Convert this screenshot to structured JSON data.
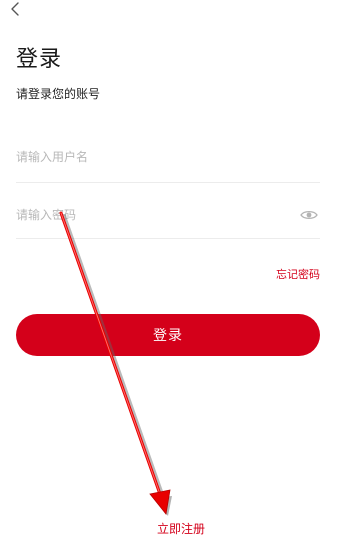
{
  "header": {
    "back_icon": "chevron-left-icon"
  },
  "page": {
    "title": "登录",
    "subtitle": "请登录您的账号"
  },
  "form": {
    "username_placeholder": "请输入用户名",
    "password_placeholder": "请输入密码",
    "username_value": "",
    "password_value": "",
    "password_toggle_icon": "eye-icon",
    "forgot_label": "忘记密码",
    "login_label": "登录"
  },
  "footer": {
    "register_label": "立即注册"
  },
  "colors": {
    "accent": "#d4001a",
    "placeholder": "#b8b8b8",
    "divider": "#ececec"
  }
}
